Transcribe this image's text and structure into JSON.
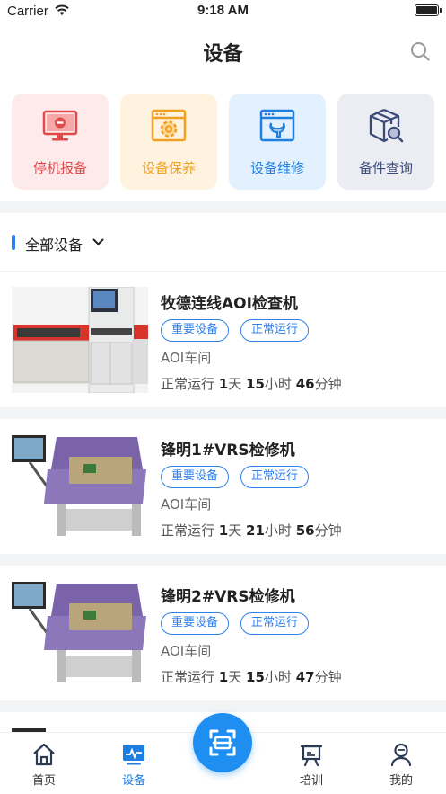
{
  "status_bar": {
    "carrier": "Carrier",
    "time": "9:18 AM",
    "battery_level": 0.9
  },
  "header": {
    "title": "设备"
  },
  "shortcuts": [
    {
      "label": "停机报备",
      "bg": "#fdebeb",
      "color": "#e2494a",
      "icon": "monitor-stop-icon"
    },
    {
      "label": "设备保养",
      "bg": "#fff3e0",
      "color": "#f0a020",
      "icon": "gear-window-icon"
    },
    {
      "label": "设备维修",
      "bg": "#e3f0fd",
      "color": "#1e7fe0",
      "icon": "wrench-window-icon"
    },
    {
      "label": "备件查询",
      "bg": "#ebedf3",
      "color": "#3c4a7a",
      "icon": "box-search-icon"
    }
  ],
  "filter": {
    "label": "全部设备"
  },
  "devices": [
    {
      "name": "牧德连线AOI检查机",
      "tags": [
        "重要设备",
        "正常运行"
      ],
      "location": "AOI车间",
      "run_label": "正常运行",
      "days": "1",
      "days_unit": "天",
      "hours": "15",
      "hours_unit": "小时",
      "minutes": "46",
      "minutes_unit": "分钟"
    },
    {
      "name": "锋明1#VRS检修机",
      "tags": [
        "重要设备",
        "正常运行"
      ],
      "location": "AOI车间",
      "run_label": "正常运行",
      "days": "1",
      "days_unit": "天",
      "hours": "21",
      "hours_unit": "小时",
      "minutes": "56",
      "minutes_unit": "分钟"
    },
    {
      "name": "锋明2#VRS检修机",
      "tags": [
        "重要设备",
        "正常运行"
      ],
      "location": "AOI车间",
      "run_label": "正常运行",
      "days": "1",
      "days_unit": "天",
      "hours": "15",
      "hours_unit": "小时",
      "minutes": "47",
      "minutes_unit": "分钟"
    }
  ],
  "tabbar": {
    "items": [
      {
        "label": "首页",
        "icon": "home-icon"
      },
      {
        "label": "设备",
        "icon": "monitor-chart-icon",
        "active": true
      },
      {
        "label": "培训",
        "icon": "easel-icon"
      },
      {
        "label": "我的",
        "icon": "user-icon"
      }
    ],
    "scan_icon": "scan-icon",
    "accent": "#1e8ff0"
  }
}
